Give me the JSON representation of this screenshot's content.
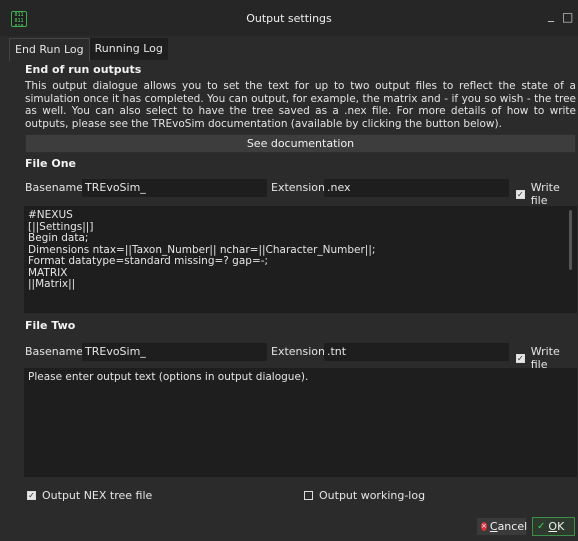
{
  "window": {
    "title": "Output settings",
    "app_icon_text": "011\n011\n010",
    "minimize_glyph": "_",
    "maximize_glyph": "□"
  },
  "tabs": [
    {
      "label": "End Run Log",
      "active": true
    },
    {
      "label": "Running Log",
      "active": false
    }
  ],
  "end_of_run": {
    "heading": "End of run outputs",
    "description": "This output dialogue allows you to set the text for up to two output files to reflect the state of a simulation once it has completed. You can output, for example, the matrix and - if you so wish - the tree as well. You can also select to have the tree saved as a .nex file. For more details of how to write outputs, please see the TREvoSim documentation (available by clicking the button below).",
    "doc_button": "See documentation"
  },
  "file_one": {
    "heading": "File One",
    "basename_label": "Basename:",
    "basename_value": "TREvoSim_",
    "extension_label": "Extension:",
    "extension_value": ".nex",
    "write_label": "Write file",
    "write_checked": true,
    "lines": [
      "#NEXUS",
      "[||Settings||]",
      "Begin data;",
      "Dimensions ntax=||Taxon_Number|| nchar=||Character_Number||;",
      "Format datatype=standard missing=? gap=-;",
      "MATRIX",
      "||Matrix||"
    ]
  },
  "file_two": {
    "heading": "File Two",
    "basename_label": "Basename:",
    "basename_value": "TREvoSim_",
    "extension_label": "Extension:",
    "extension_value": ".tnt",
    "write_label": "Write file",
    "write_checked": true,
    "text": "Please enter output text (options in output dialogue)."
  },
  "options": {
    "nex_tree_label": "Output NEX tree file",
    "nex_tree_checked": true,
    "working_log_label": "Output working-log",
    "working_log_checked": false
  },
  "footer": {
    "cancel_label": "ancel",
    "cancel_mnemonic": "C",
    "ok_label": "K",
    "ok_mnemonic": "O"
  },
  "colors": {
    "background": "#2b2b2b",
    "field": "#1e1e1e",
    "cancel_icon": "#e0303a",
    "ok_accent": "#3fd24f"
  }
}
